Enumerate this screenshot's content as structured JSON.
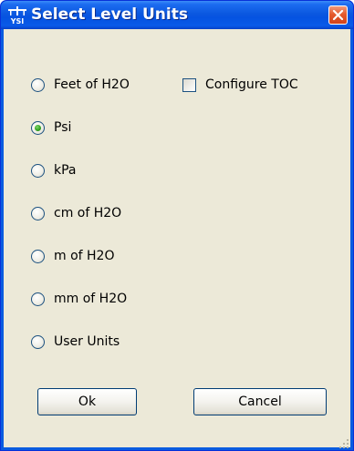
{
  "window": {
    "title": "Select Level Units",
    "title_icon": "ysi-logo-icon",
    "close_icon": "close-icon"
  },
  "units": {
    "options": [
      {
        "label": "Feet of H2O",
        "checked": false
      },
      {
        "label": "Psi",
        "checked": true
      },
      {
        "label": "kPa",
        "checked": false
      },
      {
        "label": "cm of H2O",
        "checked": false
      },
      {
        "label": "m of H2O",
        "checked": false
      },
      {
        "label": "mm of H2O",
        "checked": false
      },
      {
        "label": "User Units",
        "checked": false
      }
    ]
  },
  "configure_toc": {
    "label": "Configure TOC",
    "checked": false
  },
  "buttons": {
    "ok_label": "Ok",
    "cancel_label": "Cancel"
  },
  "colors": {
    "titlebar": "#0553e1",
    "client_background": "#ece9d8",
    "close_button": "#e55b2e",
    "radio_selected": "#2f9e1e"
  }
}
